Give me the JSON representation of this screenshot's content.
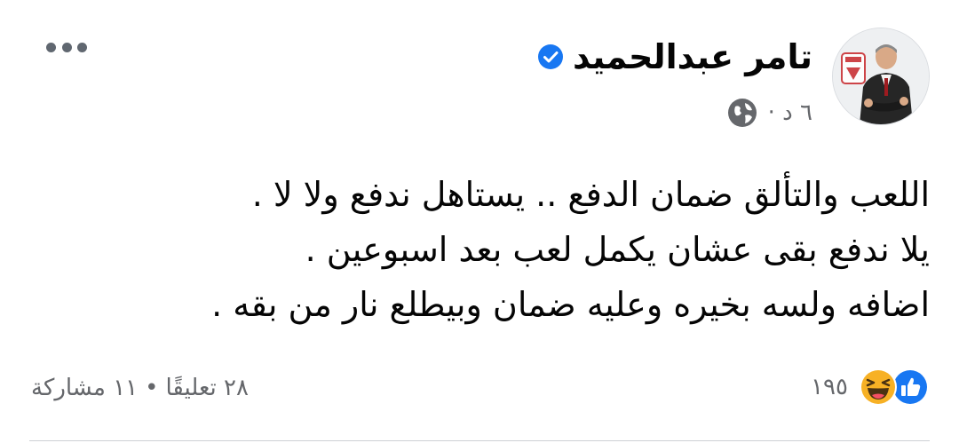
{
  "post": {
    "author_name": "تامر عبدالحميد",
    "verified_icon": "verified-badge-icon",
    "time": "٦ د ·",
    "privacy_icon": "globe-icon",
    "more_icon": "more-options-icon",
    "lines": [
      "اللعب والتألق ضمان الدفع .. يستاهل ندفع ولا لا .",
      "يلا ندفع بقى عشان يكمل لعب بعد اسبوعين .",
      "اضافه ولسه بخيره وعليه ضمان وبيطلع نار من بقه ."
    ]
  },
  "footer": {
    "reaction_icons": [
      "like-reaction-icon",
      "haha-reaction-icon"
    ],
    "reaction_count": "١٩٥",
    "comments": "٢٨ تعليقًا",
    "separator": "•",
    "shares": "١١ مشاركة"
  },
  "colors": {
    "brand_blue": "#1877f2",
    "secondary_text": "#65676b",
    "primary_text": "#050505",
    "haha_yellow": "#f7b125"
  }
}
